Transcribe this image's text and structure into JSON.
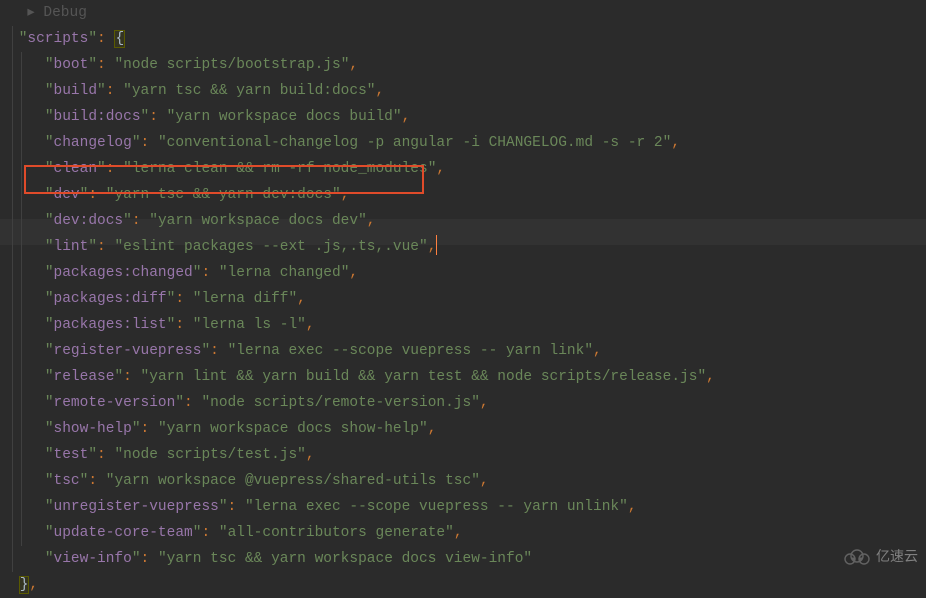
{
  "debug_label": "Debug",
  "root_key": "scripts",
  "braces": {
    "open": "{",
    "close": "}"
  },
  "scripts": [
    {
      "key": "boot",
      "val": "node scripts/bootstrap.js"
    },
    {
      "key": "build",
      "val": "yarn tsc && yarn build:docs"
    },
    {
      "key": "build:docs",
      "val": "yarn workspace docs build"
    },
    {
      "key": "changelog",
      "val": "conventional-changelog -p angular -i CHANGELOG.md -s -r 2"
    },
    {
      "key": "clean",
      "val": "lerna clean && rm -rf node_modules"
    },
    {
      "key": "dev",
      "val": "yarn tsc && yarn dev:docs"
    },
    {
      "key": "dev:docs",
      "val": "yarn workspace docs dev"
    },
    {
      "key": "lint",
      "val": "eslint packages --ext .js,.ts,.vue"
    },
    {
      "key": "packages:changed",
      "val": "lerna changed"
    },
    {
      "key": "packages:diff",
      "val": "lerna diff"
    },
    {
      "key": "packages:list",
      "val": "lerna ls -l"
    },
    {
      "key": "register-vuepress",
      "val": "lerna exec --scope vuepress -- yarn link"
    },
    {
      "key": "release",
      "val": "yarn lint && yarn build && yarn test && node scripts/release.js"
    },
    {
      "key": "remote-version",
      "val": "node scripts/remote-version.js"
    },
    {
      "key": "show-help",
      "val": "yarn workspace docs show-help"
    },
    {
      "key": "test",
      "val": "node scripts/test.js"
    },
    {
      "key": "tsc",
      "val": "yarn workspace @vuepress/shared-utils tsc"
    },
    {
      "key": "unregister-vuepress",
      "val": "lerna exec --scope vuepress -- yarn unlink"
    },
    {
      "key": "update-core-team",
      "val": "all-contributors generate"
    },
    {
      "key": "view-info",
      "val": "yarn tsc && yarn workspace docs view-info"
    }
  ],
  "highlighted_index": 5,
  "cursor_line_index": 7,
  "watermark": "亿速云"
}
